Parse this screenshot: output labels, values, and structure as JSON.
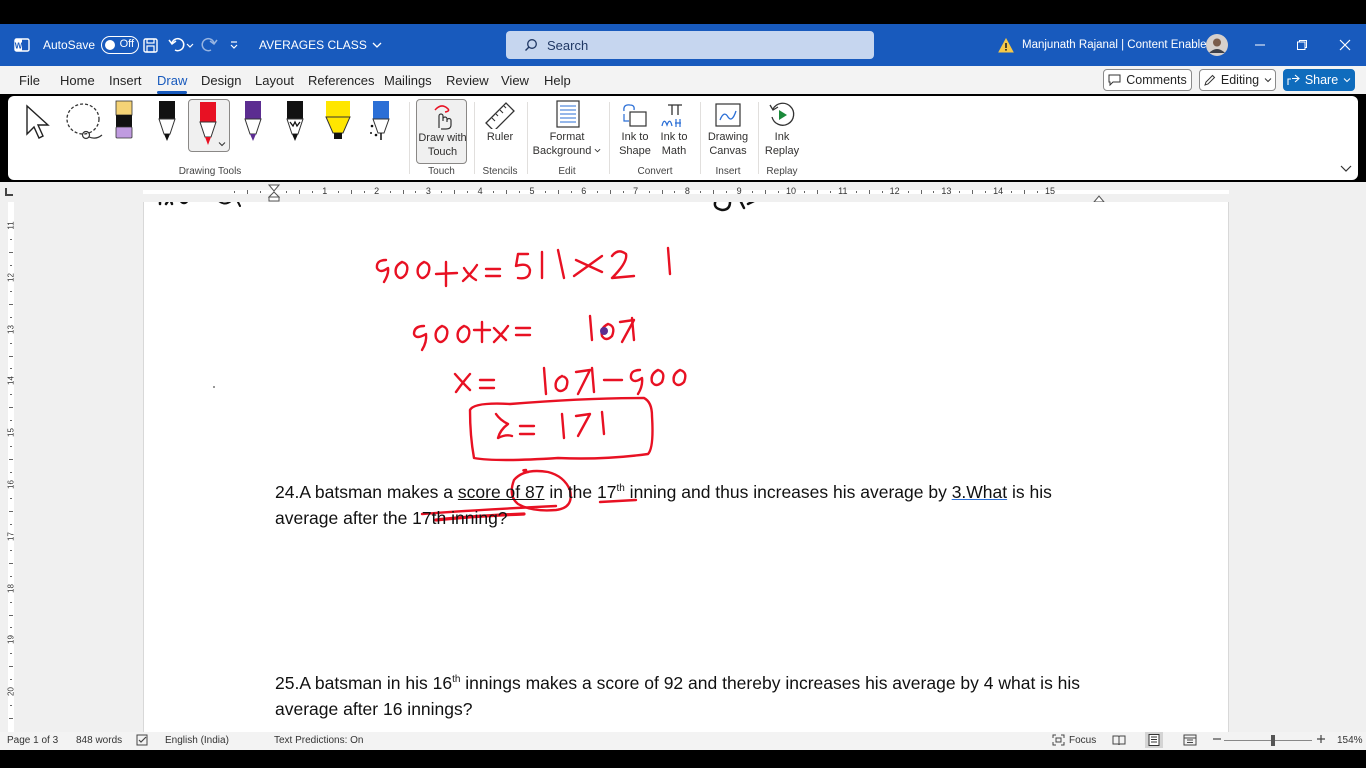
{
  "titlebar": {
    "autosave_label": "AutoSave",
    "autosave_state": "Off",
    "doc_title": "AVERAGES CLASS",
    "search_placeholder": "Search",
    "user_name": "Manjunath Rajanal | Content Enablers"
  },
  "menu": {
    "items": [
      "File",
      "Home",
      "Insert",
      "Draw",
      "Design",
      "Layout",
      "References",
      "Mailings",
      "Review",
      "View",
      "Help"
    ],
    "active": "Draw",
    "comments_label": "Comments",
    "editing_label": "Editing",
    "share_label": "Share"
  },
  "ribbon": {
    "groups": {
      "drawing_tools": "Drawing Tools",
      "touch": "Touch",
      "stencils": "Stencils",
      "edit": "Edit",
      "convert": "Convert",
      "insert": "Insert",
      "replay": "Replay"
    },
    "buttons": {
      "draw_with_touch_1": "Draw with",
      "draw_with_touch_2": "Touch",
      "ruler": "Ruler",
      "format_background_1": "Format",
      "format_background_2": "Background",
      "ink_to_shape_1": "Ink to",
      "ink_to_shape_2": "Shape",
      "ink_to_math_1": "Ink to",
      "ink_to_math_2": "Math",
      "drawing_canvas_1": "Drawing",
      "drawing_canvas_2": "Canvas",
      "ink_replay_1": "Ink",
      "ink_replay_2": "Replay"
    },
    "pens": {
      "pencil_colors": [
        "#f5d376",
        "#c09be0"
      ],
      "pen_colors": [
        "#111111",
        "#e81123",
        "#5c2d91",
        "#111111",
        "#ffe600",
        "#2b6fd6"
      ]
    }
  },
  "ruler": {
    "h_numbers": [
      "1",
      "2",
      "3",
      "4",
      "5",
      "6",
      "7",
      "8",
      "9",
      "10",
      "11",
      "12",
      "13",
      "14",
      "15"
    ],
    "v_numbers": [
      "11",
      "12",
      "13",
      "14",
      "15",
      "16",
      "17",
      "18",
      "19",
      "20"
    ]
  },
  "document": {
    "ink_color": "#e81123",
    "ink_lines": [
      "900+x = 51 X 21",
      "900+x = 1071",
      "x = 1071-900",
      "x = 171"
    ],
    "q24": {
      "p1": "24.A batsman makes a ",
      "p2": "score of 87",
      "p3": " in the 17",
      "sup": "th",
      "p4": " inning and thus increases his average by ",
      "p5": "3.What",
      "p6": " is his average after the 17th inning?"
    },
    "q25": {
      "p1": "25.A batsman in his 16",
      "sup": "th",
      "p2": " innings makes a score of 92 and thereby increases his average by 4 what is his average after 16 innings?"
    }
  },
  "status": {
    "page": "Page 1 of 3",
    "words": "848 words",
    "language": "English (India)",
    "text_predictions": "Text Predictions: On",
    "focus": "Focus",
    "zoom": "154%"
  }
}
